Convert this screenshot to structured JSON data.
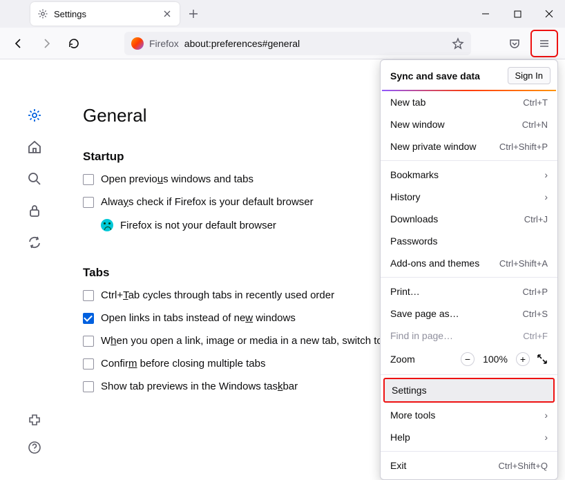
{
  "tab": {
    "title": "Settings"
  },
  "urlbar": {
    "identity": "Firefox",
    "url": "about:preferences#general"
  },
  "page": {
    "heading": "General",
    "startup": {
      "title": "Startup",
      "open_previous": "Open previous windows and tabs",
      "always_check": "Always check if Firefox is your default browser",
      "not_default": "Firefox is not your default browser"
    },
    "tabs": {
      "title": "Tabs",
      "ctrl_tab": "Ctrl+Tab cycles through tabs in recently used order",
      "open_links": "Open links in tabs instead of new windows",
      "when_open": "When you open a link, image or media in a new tab, switch to it",
      "confirm": "Confirm before closing multiple tabs",
      "show_previews": "Show tab previews in the Windows taskbar"
    }
  },
  "menu": {
    "sync_title": "Sync and save data",
    "sign_in": "Sign In",
    "new_tab": {
      "label": "New tab",
      "shortcut": "Ctrl+T"
    },
    "new_window": {
      "label": "New window",
      "shortcut": "Ctrl+N"
    },
    "new_private": {
      "label": "New private window",
      "shortcut": "Ctrl+Shift+P"
    },
    "bookmarks": "Bookmarks",
    "history": "History",
    "downloads": {
      "label": "Downloads",
      "shortcut": "Ctrl+J"
    },
    "passwords": "Passwords",
    "addons": {
      "label": "Add-ons and themes",
      "shortcut": "Ctrl+Shift+A"
    },
    "print": {
      "label": "Print…",
      "shortcut": "Ctrl+P"
    },
    "save_as": {
      "label": "Save page as…",
      "shortcut": "Ctrl+S"
    },
    "find": {
      "label": "Find in page…",
      "shortcut": "Ctrl+F"
    },
    "zoom": {
      "label": "Zoom",
      "value": "100%"
    },
    "settings": "Settings",
    "more_tools": "More tools",
    "help": "Help",
    "exit": {
      "label": "Exit",
      "shortcut": "Ctrl+Shift+Q"
    }
  }
}
